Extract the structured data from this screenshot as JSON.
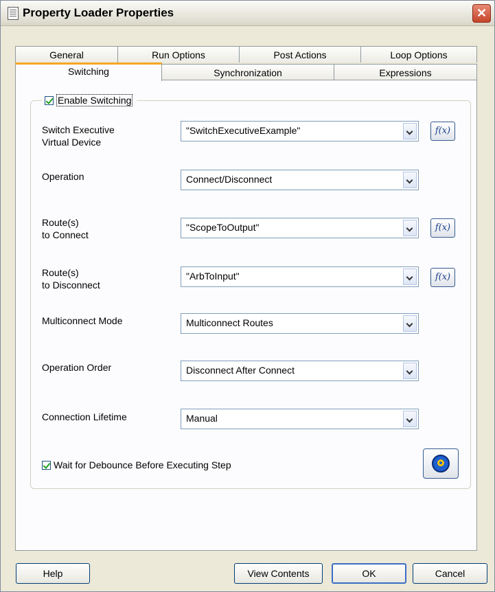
{
  "window": {
    "title": "Property Loader Properties",
    "close_glyph": "✕"
  },
  "tabs_row1": [
    {
      "label": "General"
    },
    {
      "label": "Run Options"
    },
    {
      "label": "Post Actions"
    },
    {
      "label": "Loop Options"
    }
  ],
  "tabs_row2": [
    {
      "label": "Switching"
    },
    {
      "label": "Synchronization"
    },
    {
      "label": "Expressions"
    }
  ],
  "switching": {
    "enable_label": "Enable Switching",
    "enable_checked": true,
    "fields": [
      {
        "label": "Switch Executive\nVirtual Device",
        "value": "\"SwitchExecutiveExample\"",
        "has_fx": true
      },
      {
        "label": "Operation",
        "value": "Connect/Disconnect",
        "has_fx": false
      },
      {
        "label": "Route(s)\nto Connect",
        "value": "\"ScopeToOutput\"",
        "has_fx": true
      },
      {
        "label": "Route(s)\nto Disconnect",
        "value": "\"ArbToInput\"",
        "has_fx": true
      },
      {
        "label": "Multiconnect Mode",
        "value": "Multiconnect Routes",
        "has_fx": false
      },
      {
        "label": "Operation Order",
        "value": "Disconnect After Connect",
        "has_fx": false
      },
      {
        "label": "Connection Lifetime",
        "value": "Manual",
        "has_fx": false
      }
    ],
    "fx_label": "f(x)",
    "wait_label": "Wait for Debounce Before Executing Step",
    "wait_checked": true,
    "icon_button": "switch-executive-icon"
  },
  "buttons": {
    "help": "Help",
    "view_contents": "View Contents",
    "ok": "OK",
    "cancel": "Cancel"
  }
}
